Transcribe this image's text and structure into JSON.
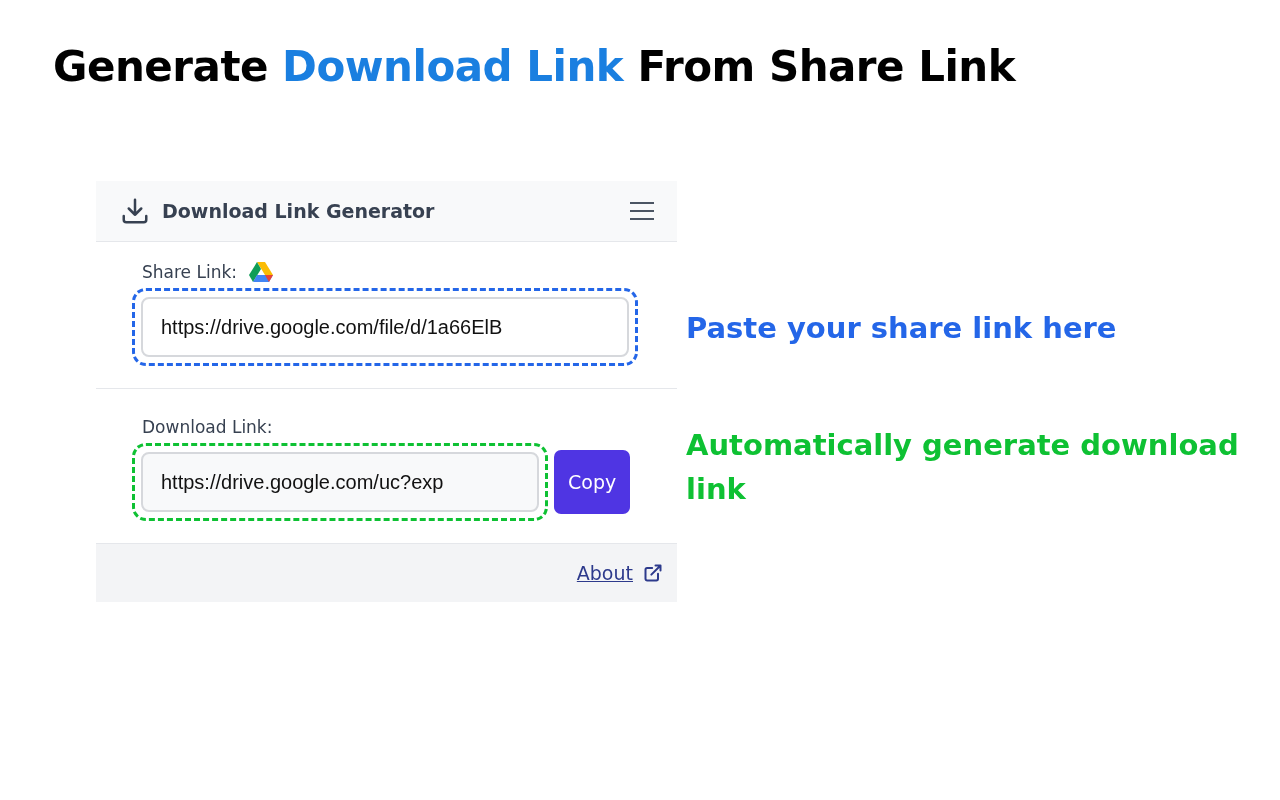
{
  "headline": [
    {
      "text": "Generate",
      "highlight": false
    },
    {
      "text": "Download Link",
      "highlight": true
    },
    {
      "text": "From Share Link",
      "highlight": false
    }
  ],
  "app": {
    "title": "Download Link Generator",
    "share": {
      "label": "Share Link:",
      "value": "https://drive.google.com/file/d/1a66ElB",
      "callout": {
        "text": "Paste your share link here",
        "color": "#2466e8"
      }
    },
    "download": {
      "label": "Download Link:",
      "value": "https://drive.google.com/uc?exp",
      "button": "Copy",
      "callout": {
        "text": "Automatically generate download link",
        "color": "#0ec133"
      }
    },
    "footer": {
      "link": "About"
    }
  }
}
